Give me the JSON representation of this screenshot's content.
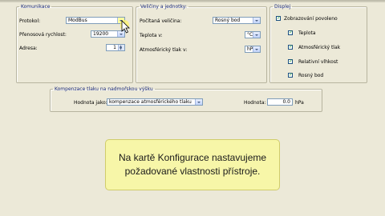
{
  "communication": {
    "title": "Komunikace",
    "protocol_label": "Protokol:",
    "protocol_value": "ModBus",
    "baud_label": "Přenosová rychlost:",
    "baud_value": "19200",
    "address_label": "Adresa:",
    "address_value": "1"
  },
  "quantities": {
    "title": "Veličiny a jednotky:",
    "computed_label": "Počítaná veličina:",
    "computed_value": "Rosný bod",
    "temperature_label": "Teplota v:",
    "temperature_value": "°C",
    "pressure_label": "Atmosférický tlak v:",
    "pressure_value": "hPa"
  },
  "display": {
    "title": "Displej",
    "items": [
      {
        "label": "Zobrazování povoleno",
        "checked": true
      },
      {
        "label": "Teplota",
        "checked": true
      },
      {
        "label": "Atmosférický tlak",
        "checked": true
      },
      {
        "label": "Relativní vlhkost",
        "checked": true
      },
      {
        "label": "Rosný bod",
        "checked": true
      }
    ]
  },
  "compensation": {
    "title": "Kompenzace tlaku na nadmořskou výšku",
    "mode_label": "Hodnota jako:",
    "mode_value": "kompenzace atmosférického tlaku",
    "value_label": "Hodnota:",
    "value": "0.0",
    "unit": "hPa"
  },
  "callout": {
    "line1": "Na kartě Konfigurace nastavujeme",
    "line2": "požadované vlastnosti přístroje."
  }
}
